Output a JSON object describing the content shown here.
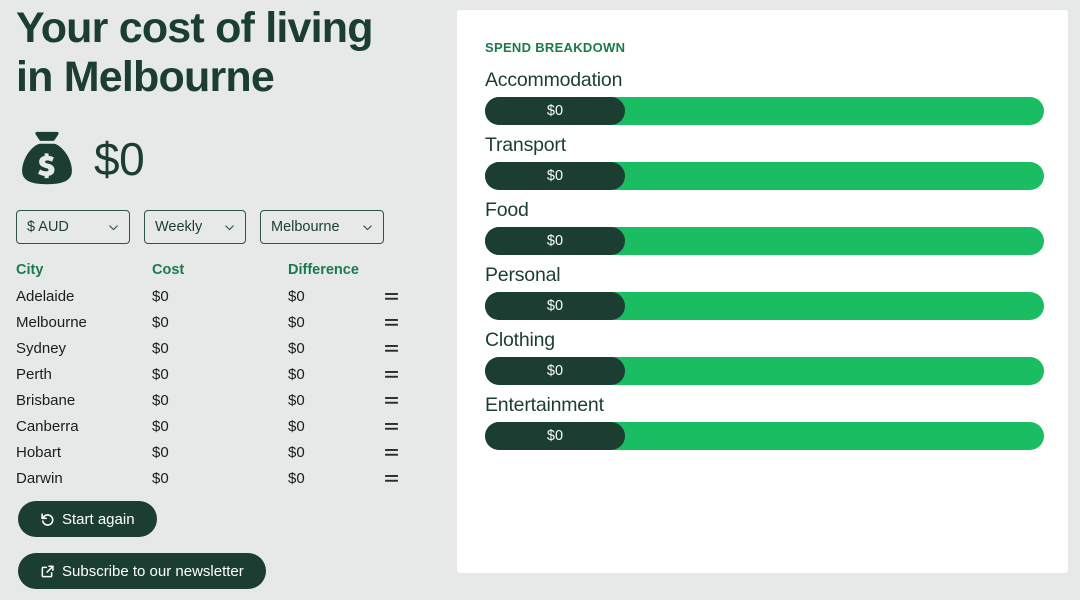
{
  "header": {
    "title_line1": "Your cost of living",
    "title_line2": "in Melbourne",
    "total_amount": "$0",
    "bag_icon": "money-bag-icon"
  },
  "controls": {
    "currency": {
      "value": "$ AUD",
      "icon": "chevron-down-icon"
    },
    "frequency": {
      "value": "Weekly",
      "icon": "chevron-down-icon"
    },
    "city": {
      "value": "Melbourne",
      "icon": "chevron-down-icon"
    }
  },
  "table": {
    "columns": [
      "City",
      "Cost",
      "Difference",
      ""
    ],
    "rows": [
      {
        "city": "Adelaide",
        "cost": "$0",
        "difference": "$0",
        "indicator": "equals-icon"
      },
      {
        "city": "Melbourne",
        "cost": "$0",
        "difference": "$0",
        "indicator": "equals-icon"
      },
      {
        "city": "Sydney",
        "cost": "$0",
        "difference": "$0",
        "indicator": "equals-icon"
      },
      {
        "city": "Perth",
        "cost": "$0",
        "difference": "$0",
        "indicator": "equals-icon"
      },
      {
        "city": "Brisbane",
        "cost": "$0",
        "difference": "$0",
        "indicator": "equals-icon"
      },
      {
        "city": "Canberra",
        "cost": "$0",
        "difference": "$0",
        "indicator": "equals-icon"
      },
      {
        "city": "Hobart",
        "cost": "$0",
        "difference": "$0",
        "indicator": "equals-icon"
      },
      {
        "city": "Darwin",
        "cost": "$0",
        "difference": "$0",
        "indicator": "equals-icon"
      }
    ]
  },
  "actions": {
    "restart": {
      "label": "Start again",
      "icon": "undo-arrow-icon"
    },
    "subscribe": {
      "label": "Subscribe to our newsletter",
      "icon": "external-link-icon"
    }
  },
  "breakdown": {
    "eyebrow": "Spend breakdown",
    "items": [
      {
        "label": "Accommodation",
        "value": "$0"
      },
      {
        "label": "Transport",
        "value": "$0"
      },
      {
        "label": "Food",
        "value": "$0"
      },
      {
        "label": "Personal",
        "value": "$0"
      },
      {
        "label": "Clothing",
        "value": "$0"
      },
      {
        "label": "Entertainment",
        "value": "$0"
      }
    ]
  },
  "colors": {
    "background": "#e6e9e7",
    "dark_green": "#1b3d32",
    "bright_green": "#1bbd63",
    "accent_green": "#1a7a4c",
    "card_white": "#ffffff"
  }
}
